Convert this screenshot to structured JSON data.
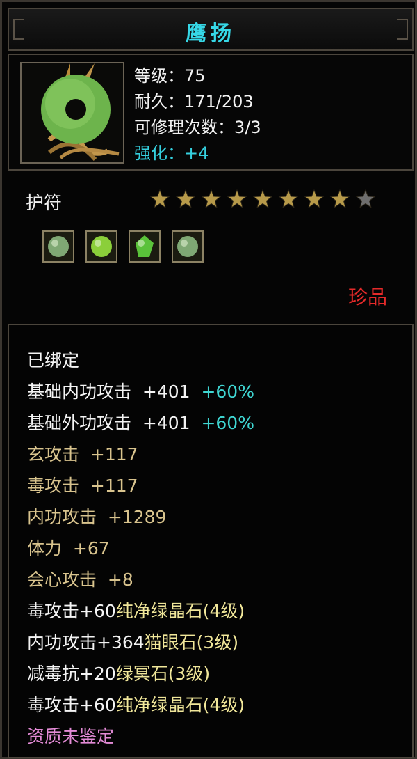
{
  "item": {
    "name": "鹰扬",
    "stats": {
      "level": "等级：75",
      "durability": "耐久：171/203",
      "repair_count": "可修理次数：3/3",
      "strength": "强化：+4"
    },
    "type": "护符",
    "stars": {
      "total": 9,
      "filled": 8
    },
    "gems": [
      "white-green-gem-icon",
      "green-gem-icon",
      "green-crystal-icon",
      "white-green-gem-icon"
    ],
    "rarity": "珍品"
  },
  "attributes": [
    {
      "text": "已绑定",
      "extra": "",
      "color": "white"
    },
    {
      "text": "基础内功攻击  +401",
      "extra": "  +60%",
      "color": "white"
    },
    {
      "text": "基础外功攻击  +401",
      "extra": "  +60%",
      "color": "white"
    },
    {
      "text": "玄攻击  +117",
      "extra": "",
      "color": "tan"
    },
    {
      "text": "毒攻击  +117",
      "extra": "",
      "color": "tan"
    },
    {
      "text": "内功攻击  +1289",
      "extra": "",
      "color": "tan"
    },
    {
      "text": "体力  +67",
      "extra": "",
      "color": "tan"
    },
    {
      "text": "会心攻击  +8",
      "extra": "",
      "color": "tan"
    },
    {
      "text": "毒攻击+60",
      "extra": "纯净绿晶石(4级)",
      "color": "white"
    },
    {
      "text": "内功攻击+364",
      "extra": "猫眼石(3级)",
      "color": "white"
    },
    {
      "text": "减毒抗+20",
      "extra": "绿冥石(3级)",
      "color": "white"
    },
    {
      "text": "毒攻击+60",
      "extra": "纯净绿晶石(4级)",
      "color": "white"
    },
    {
      "text": "资质未鉴定",
      "extra": "",
      "color": "pink"
    }
  ],
  "colors": {
    "title": "#36d7e6",
    "strength": "#35d0df",
    "rarity": "#e52a2a",
    "gold_star": "#b79a4a",
    "gray_star": "#6e6e6e"
  }
}
